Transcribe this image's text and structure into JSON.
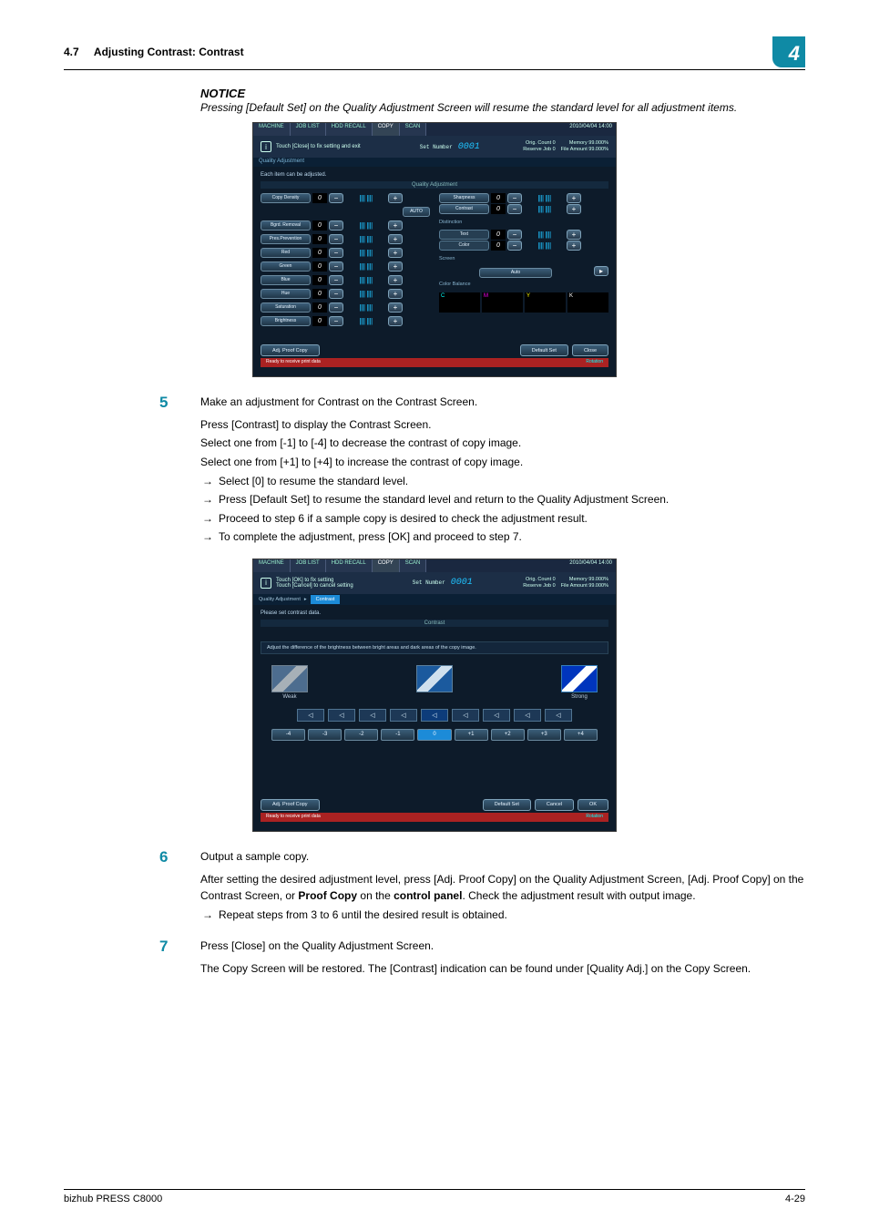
{
  "header": {
    "section_num": "4.7",
    "section_title": "Adjusting Contrast: Contrast",
    "chapter": "4"
  },
  "notice": {
    "title": "NOTICE",
    "body": "Pressing [Default Set] on the Quality Adjustment Screen will resume the standard level for all adjustment items."
  },
  "screenshot1": {
    "tabs": [
      "MACHINE",
      "JOB LIST",
      "HDD RECALL",
      "COPY",
      "SCAN"
    ],
    "datetime": "2010/04/04 14:00",
    "hint": "Touch [Close] to fix setting and exit",
    "set_label": "Set Number",
    "set_number": "0001",
    "meta_lines": [
      "Orig. Count 0",
      "Reserve Job 0",
      "Memory 99.000%",
      "File Amount 99.000%"
    ],
    "bar_label": "Quality Adjustment",
    "subhint": "Each item can be adjusted.",
    "section_title": "Quality Adjustment",
    "left_items": [
      {
        "label": "Copy Density",
        "v": "0"
      },
      {
        "label": "Bgrd. Removal",
        "v": "0"
      },
      {
        "label": "Pres.Prevention",
        "v": "0"
      },
      {
        "label": "Red",
        "v": "0"
      },
      {
        "label": "Green",
        "v": "0"
      },
      {
        "label": "Blue",
        "v": "0"
      },
      {
        "label": "Hue",
        "v": "0"
      },
      {
        "label": "Saturation",
        "v": "0"
      },
      {
        "label": "Brightness",
        "v": "0"
      }
    ],
    "right_items": [
      {
        "label": "Sharpness",
        "v": "0"
      },
      {
        "label": "Contrast",
        "v": "0"
      }
    ],
    "distinction_label": "Distinction",
    "distinction_items": [
      {
        "label": "Text",
        "v": "0"
      },
      {
        "label": "Color",
        "v": "0"
      }
    ],
    "screen_label": "Screen",
    "auto_label": "Auto",
    "auto_btn": "AUTO",
    "color_balance": "Color Balance",
    "cmyk": [
      "C",
      "M",
      "Y",
      "K"
    ],
    "adj_proof": "Adj. Proof Copy",
    "default_set": "Default Set",
    "close": "Close",
    "status": "Ready to receive print data",
    "rotation": "Rotation"
  },
  "screenshot2": {
    "tabs": [
      "MACHINE",
      "JOB LIST",
      "HDD RECALL",
      "COPY",
      "SCAN"
    ],
    "datetime": "2010/04/04 14:00",
    "hint_l1": "Touch [OK] to fix setting",
    "hint_l2": "Touch [Cancel] to cancel setting",
    "set_label": "Set Number",
    "set_number": "0001",
    "meta_lines": [
      "Orig. Count 0",
      "Reserve Job 0",
      "Memory 99.000%",
      "File Amount 99.000%"
    ],
    "crumb1": "Quality Adjustment",
    "crumb2": "Contrast",
    "subhint": "Please set contrast data.",
    "title": "Contrast",
    "desc": "Adjust the difference of the brightness between bright areas and dark areas of the copy image.",
    "weak": "Weak",
    "strong": "Strong",
    "levels": [
      "-4",
      "-3",
      "-2",
      "-1",
      "0",
      "+1",
      "+2",
      "+3",
      "+4"
    ],
    "adj_proof": "Adj. Proof Copy",
    "default_set": "Default Set",
    "cancel": "Cancel",
    "ok": "OK",
    "status": "Ready to receive print data",
    "rotation": "Rotation"
  },
  "step5": {
    "num": "5",
    "line1": "Make an adjustment for Contrast on the Contrast Screen.",
    "p1": "Press [Contrast] to display the Contrast Screen.",
    "p2": "Select one from [-1] to [-4] to decrease the contrast of copy image.",
    "p3": "Select one from [+1] to [+4] to increase the contrast of copy image.",
    "b1": "Select [0] to resume the standard level.",
    "b2": "Press [Default Set] to resume the standard level and return to the Quality Adjustment Screen.",
    "b3": "Proceed to step 6 if a sample copy is desired to check the adjustment result.",
    "b4": "To complete the adjustment, press [OK] and proceed to step 7."
  },
  "step6": {
    "num": "6",
    "line1": "Output a sample copy.",
    "p1": "After setting the desired adjustment level, press [Adj. Proof Copy] on the Quality Adjustment Screen, [Adj. Proof Copy] on the Contrast Screen, or ",
    "p1b": "Proof Copy",
    "p1c": " on the ",
    "p1d": "control panel",
    "p1e": ". Check the adjustment result with output image.",
    "b1": "Repeat steps from 3 to 6 until the desired result is obtained."
  },
  "step7": {
    "num": "7",
    "line1": "Press [Close] on the Quality Adjustment Screen.",
    "p1": "The Copy Screen will be restored. The [Contrast] indication can be found under [Quality Adj.] on the Copy Screen."
  },
  "footer": {
    "product": "bizhub PRESS C8000",
    "page": "4-29"
  }
}
